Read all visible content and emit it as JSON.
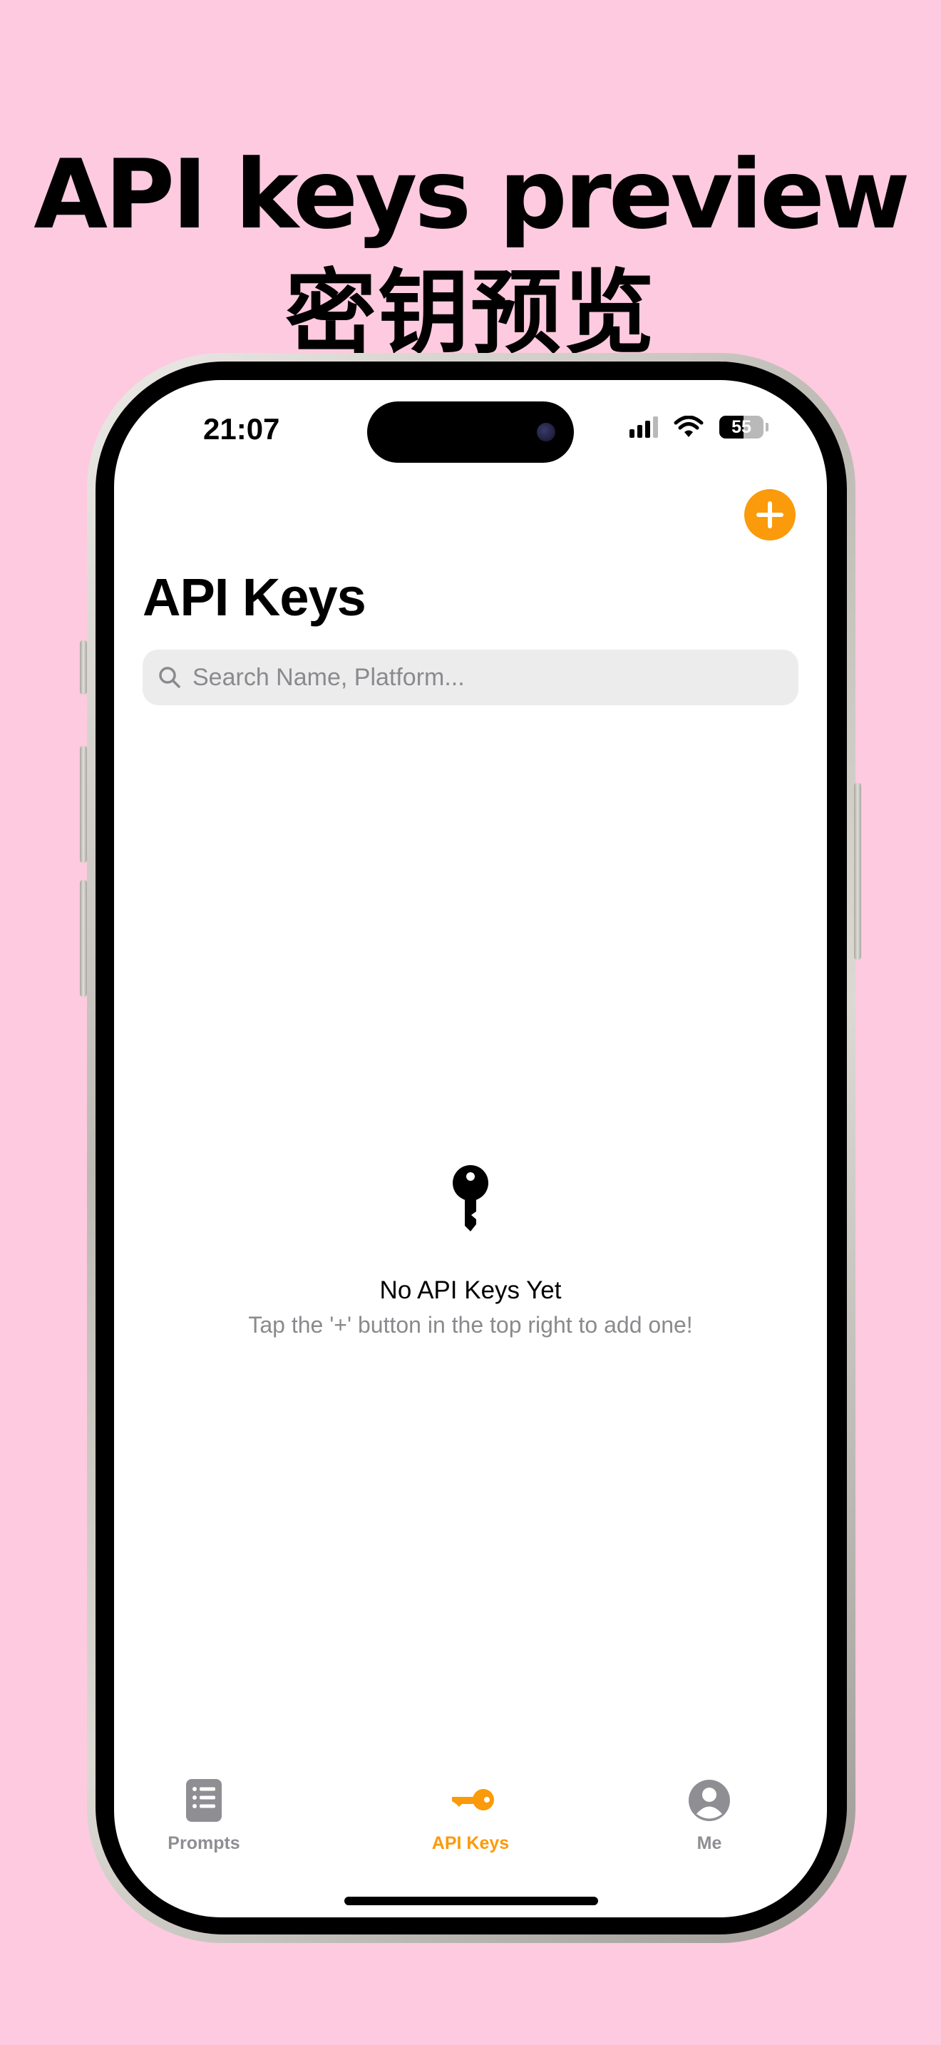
{
  "promo": {
    "title_line1": "API keys preview",
    "title_line2": "密钥预览"
  },
  "status_bar": {
    "time": "21:07",
    "battery": "55",
    "battery_level": 0.55
  },
  "header": {
    "title": "API Keys",
    "add_button_icon": "plus-icon"
  },
  "search": {
    "placeholder": "Search Name, Platform...",
    "value": ""
  },
  "empty_state": {
    "icon": "key-icon",
    "title": "No API Keys Yet",
    "subtitle": "Tap the '+' button in the top right to add one!"
  },
  "tab_bar": {
    "tabs": [
      {
        "label": "Prompts",
        "icon": "document-list-icon",
        "active": false
      },
      {
        "label": "API Keys",
        "icon": "key-icon",
        "active": true
      },
      {
        "label": "Me",
        "icon": "person-icon",
        "active": false
      }
    ]
  },
  "colors": {
    "background": "#fdcadf",
    "accent": "#fb9a0a",
    "inactive_tab": "#8e8e93",
    "search_fill": "#ececec"
  }
}
